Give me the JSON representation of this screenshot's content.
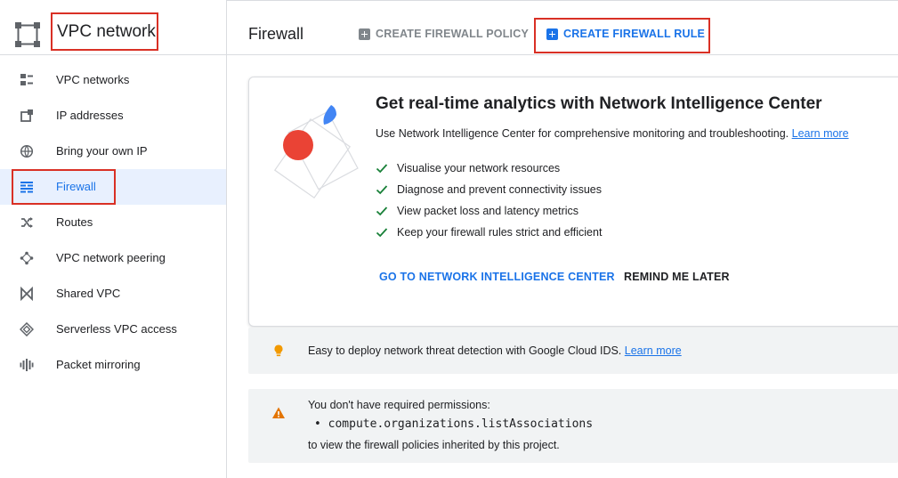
{
  "product": {
    "title": "VPC network",
    "icon": "vpc-network-icon"
  },
  "sidebar": {
    "items": [
      {
        "label": "VPC networks",
        "icon": "vpc-networks-icon"
      },
      {
        "label": "IP addresses",
        "icon": "ip-addresses-icon"
      },
      {
        "label": "Bring your own IP",
        "icon": "globe-icon"
      },
      {
        "label": "Firewall",
        "icon": "firewall-icon",
        "active": true
      },
      {
        "label": "Routes",
        "icon": "routes-icon"
      },
      {
        "label": "VPC network peering",
        "icon": "peering-icon"
      },
      {
        "label": "Shared VPC",
        "icon": "shared-vpc-icon"
      },
      {
        "label": "Serverless VPC access",
        "icon": "serverless-icon"
      },
      {
        "label": "Packet mirroring",
        "icon": "packet-mirroring-icon"
      }
    ]
  },
  "toolbar": {
    "page_title": "Firewall",
    "create_policy_label": "CREATE FIREWALL POLICY",
    "create_rule_label": "CREATE FIREWALL RULE"
  },
  "promo": {
    "title": "Get real-time analytics with Network Intelligence Center",
    "description": "Use Network Intelligence Center for comprehensive monitoring and troubleshooting.",
    "learn_more": "Learn more",
    "checklist": [
      "Visualise your network resources",
      "Diagnose and prevent connectivity issues",
      "View packet loss and latency metrics",
      "Keep your firewall rules strict and efficient"
    ],
    "go_label": "GO TO NETWORK INTELLIGENCE CENTER",
    "remind_label": "REMIND ME LATER"
  },
  "ids_banner": {
    "text": "Easy to deploy network threat detection with Google Cloud IDS.",
    "learn_more": "Learn more"
  },
  "permission_banner": {
    "line1": "You don't have required permissions:",
    "permission": "•  compute.organizations.listAssociations",
    "line3": "to view the firewall policies inherited by this project."
  },
  "colors": {
    "accent": "#1a73e8",
    "highlight_border": "#d93025",
    "check": "#188038",
    "bulb": "#f29900",
    "warning": "#e37400",
    "illustration_red": "#ea4335",
    "illustration_blue": "#4285f4"
  }
}
